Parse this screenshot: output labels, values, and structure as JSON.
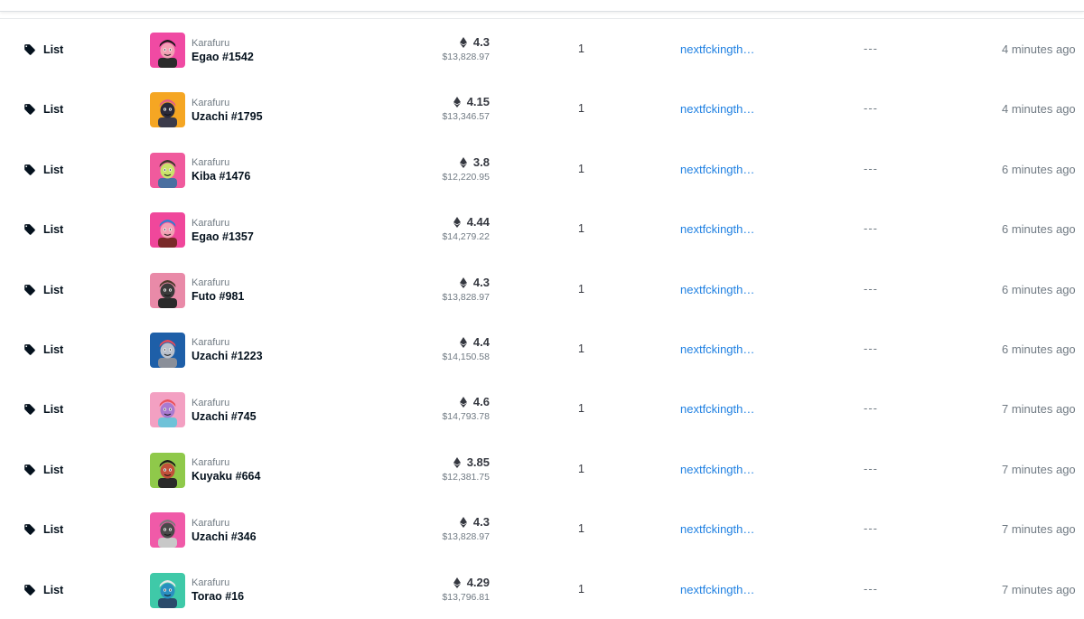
{
  "rows": [
    {
      "event": "List",
      "collection": "Karafuru",
      "name": "Egao #1542",
      "price_eth": "4.3",
      "price_usd": "$13,828.97",
      "quantity": "1",
      "from": "nextfckingth…",
      "to": "---",
      "time": "4 minutes ago",
      "thumb": {
        "bg": "#f04aa3",
        "hair": "#1a1a1a",
        "face": "#f2a0b4",
        "shirt": "#2b2b2b"
      }
    },
    {
      "event": "List",
      "collection": "Karafuru",
      "name": "Uzachi #1795",
      "price_eth": "4.15",
      "price_usd": "$13,346.57",
      "quantity": "1",
      "from": "nextfckingth…",
      "to": "---",
      "time": "4 minutes ago",
      "thumb": {
        "bg": "#f5a623",
        "hair": "#e05a8a",
        "face": "#2a2a3a",
        "shirt": "#3b3b4a"
      }
    },
    {
      "event": "List",
      "collection": "Karafuru",
      "name": "Kiba #1476",
      "price_eth": "3.8",
      "price_usd": "$12,220.95",
      "quantity": "1",
      "from": "nextfckingth…",
      "to": "---",
      "time": "6 minutes ago",
      "thumb": {
        "bg": "#f05a9d",
        "hair": "#3a3a2a",
        "face": "#c9e36b",
        "shirt": "#4a6fa0"
      }
    },
    {
      "event": "List",
      "collection": "Karafuru",
      "name": "Egao #1357",
      "price_eth": "4.44",
      "price_usd": "$14,279.22",
      "quantity": "1",
      "from": "nextfckingth…",
      "to": "---",
      "time": "6 minutes ago",
      "thumb": {
        "bg": "#f0479b",
        "hair": "#2f7fd0",
        "face": "#f2a0b4",
        "shirt": "#7a2a2a"
      }
    },
    {
      "event": "List",
      "collection": "Karafuru",
      "name": "Futo #981",
      "price_eth": "4.3",
      "price_usd": "$13,828.97",
      "quantity": "1",
      "from": "nextfckingth…",
      "to": "---",
      "time": "6 minutes ago",
      "thumb": {
        "bg": "#e98aa8",
        "hair": "#4a3a2a",
        "face": "#3a3a3a",
        "shirt": "#2a2a2a"
      }
    },
    {
      "event": "List",
      "collection": "Karafuru",
      "name": "Uzachi #1223",
      "price_eth": "4.4",
      "price_usd": "$14,150.58",
      "quantity": "1",
      "from": "nextfckingth…",
      "to": "---",
      "time": "6 minutes ago",
      "thumb": {
        "bg": "#1e5fa8",
        "hair": "#e84a5a",
        "face": "#b9c0cc",
        "shirt": "#8a8f99"
      }
    },
    {
      "event": "List",
      "collection": "Karafuru",
      "name": "Uzachi #745",
      "price_eth": "4.6",
      "price_usd": "$14,793.78",
      "quantity": "1",
      "from": "nextfckingth…",
      "to": "---",
      "time": "7 minutes ago",
      "thumb": {
        "bg": "#f3a0c2",
        "hair": "#e8505a",
        "face": "#a87ad0",
        "shirt": "#6fc2d8"
      }
    },
    {
      "event": "List",
      "collection": "Karafuru",
      "name": "Kuyaku #664",
      "price_eth": "3.85",
      "price_usd": "$12,381.75",
      "quantity": "1",
      "from": "nextfckingth…",
      "to": "---",
      "time": "7 minutes ago",
      "thumb": {
        "bg": "#8fc94a",
        "hair": "#1a1a1a",
        "face": "#c0503a",
        "shirt": "#2a2a2a"
      }
    },
    {
      "event": "List",
      "collection": "Karafuru",
      "name": "Uzachi #346",
      "price_eth": "4.3",
      "price_usd": "$13,828.97",
      "quantity": "1",
      "from": "nextfckingth…",
      "to": "---",
      "time": "7 minutes ago",
      "thumb": {
        "bg": "#f05aa8",
        "hair": "#7a7a7a",
        "face": "#4a4a4a",
        "shirt": "#c8c8c8"
      }
    },
    {
      "event": "List",
      "collection": "Karafuru",
      "name": "Torao #16",
      "price_eth": "4.29",
      "price_usd": "$13,796.81",
      "quantity": "1",
      "from": "nextfckingth…",
      "to": "---",
      "time": "7 minutes ago",
      "thumb": {
        "bg": "#3fc9a8",
        "hair": "#e8e8e8",
        "face": "#2a8fc0",
        "shirt": "#2a4a6a"
      }
    }
  ]
}
